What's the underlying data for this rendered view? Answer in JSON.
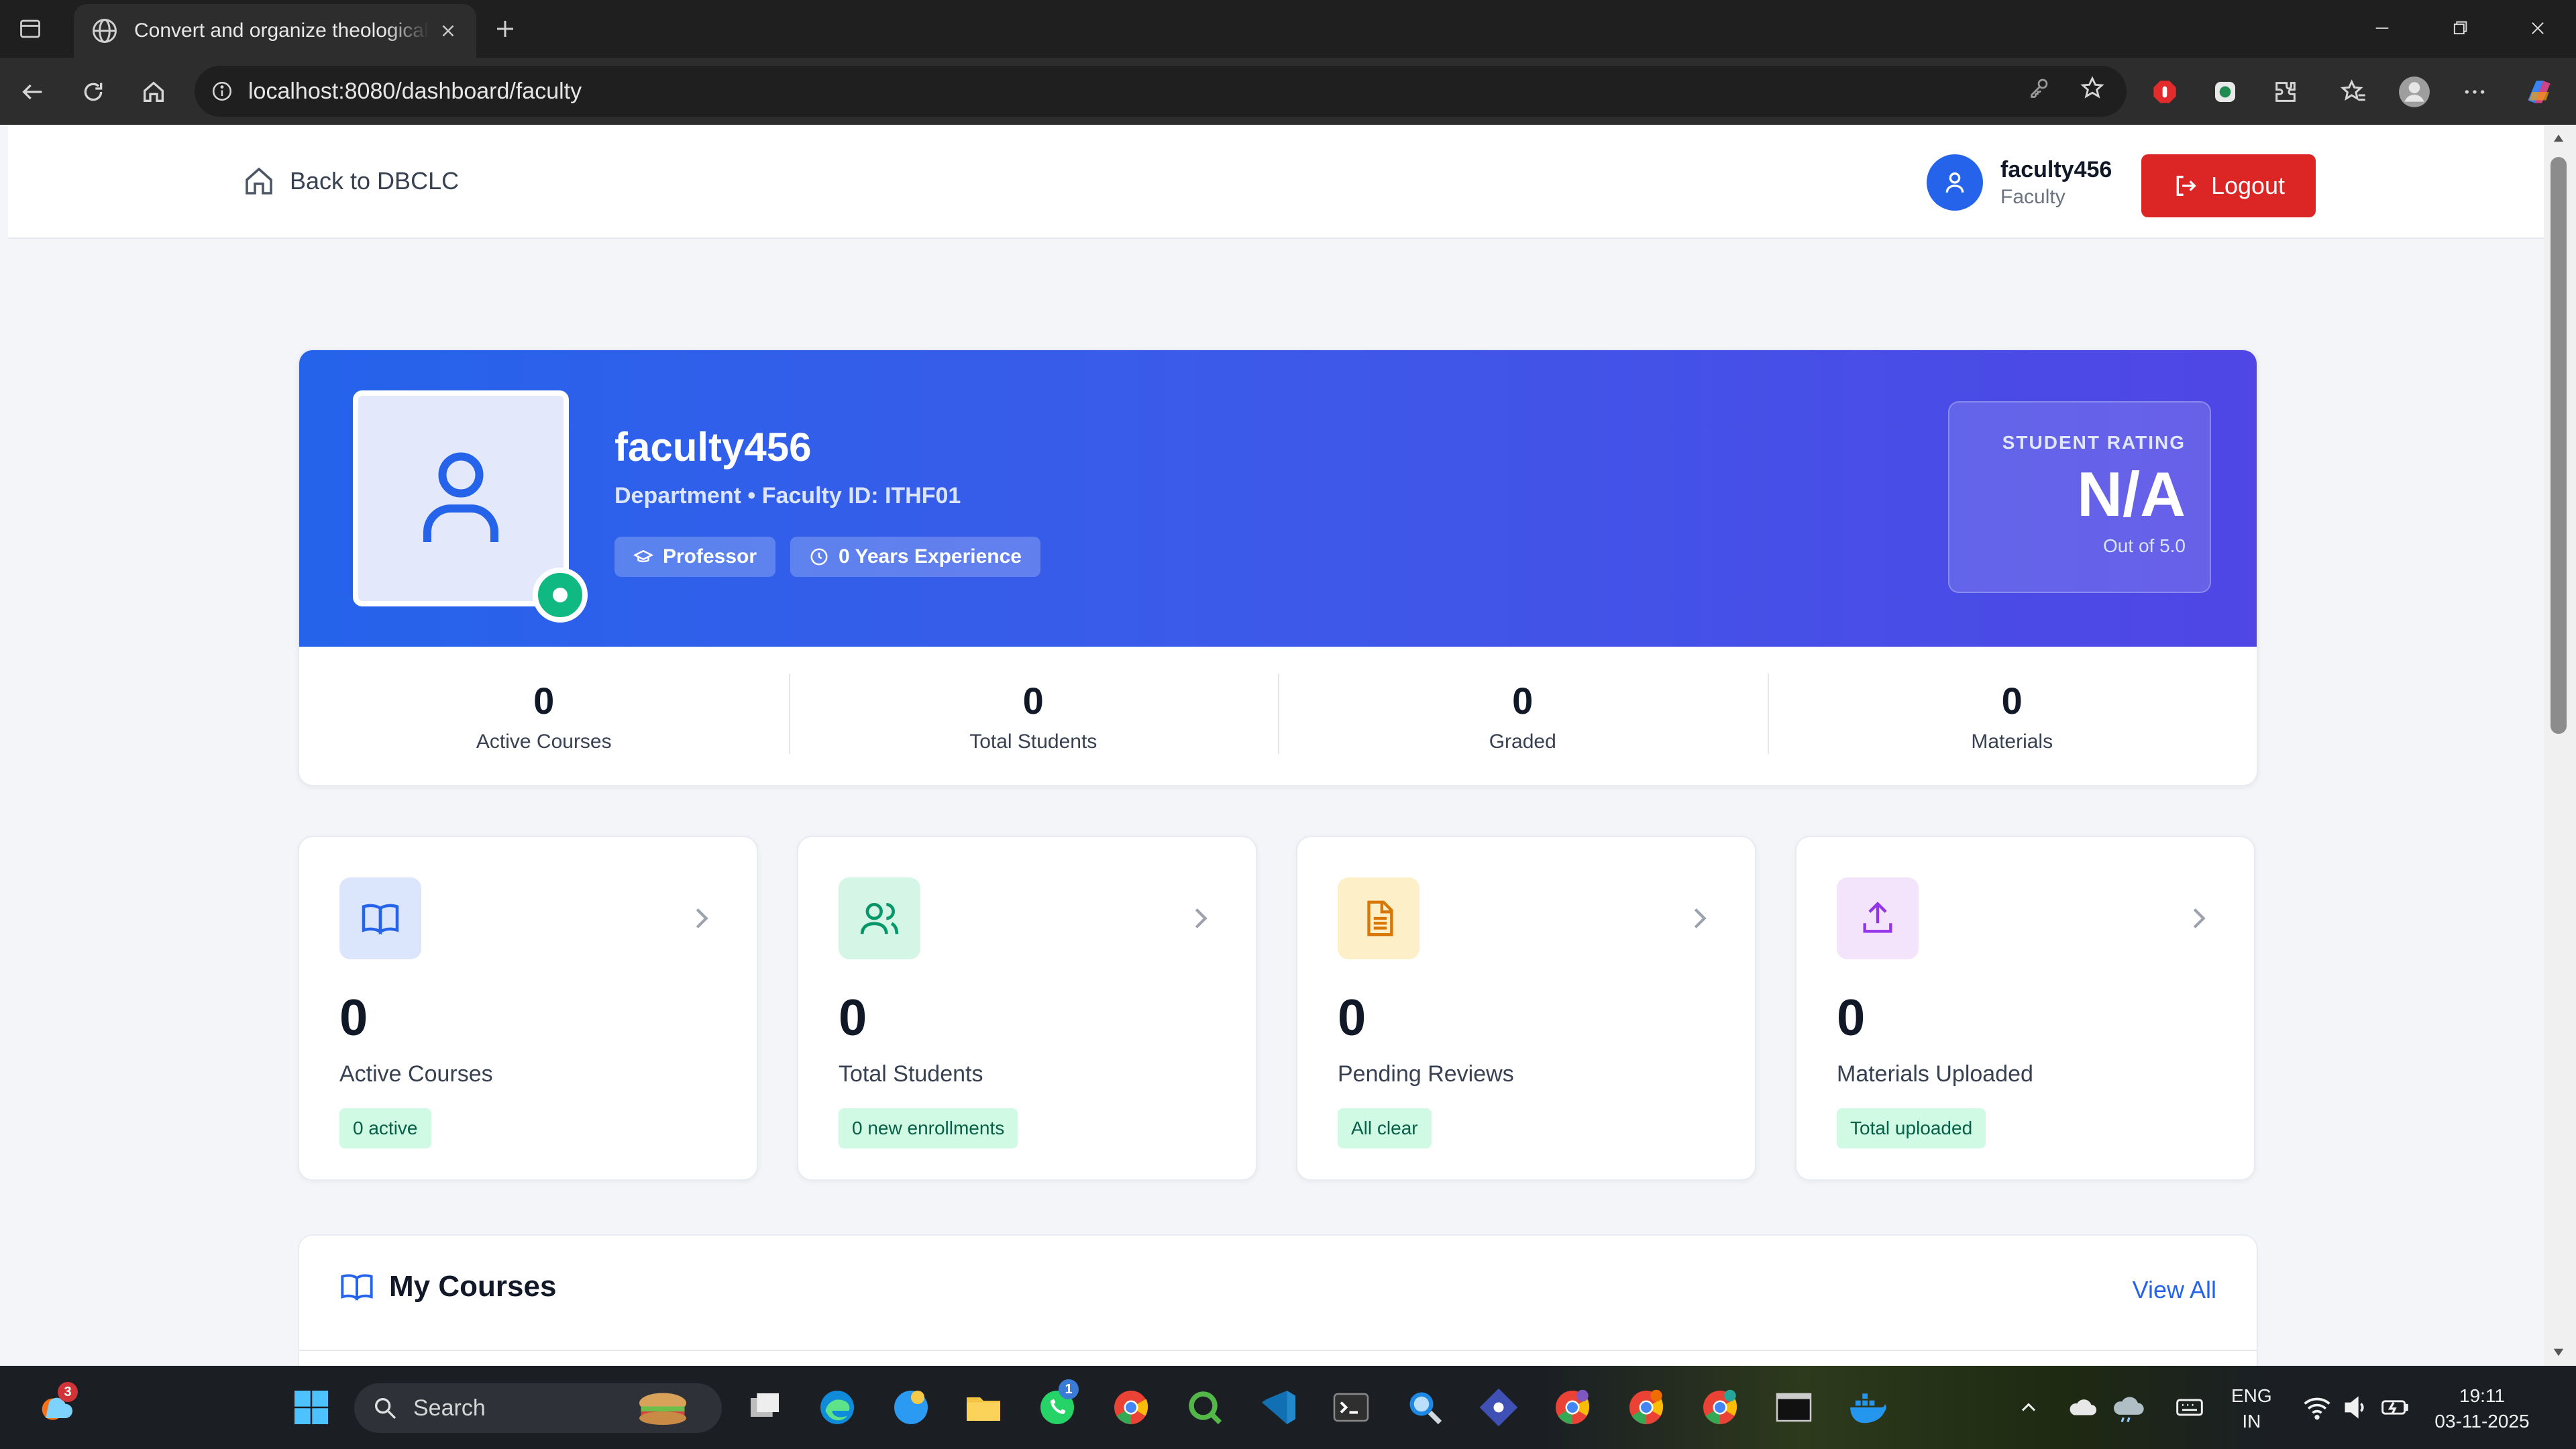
{
  "browser": {
    "tab_title": "Convert and organize theological",
    "url": "localhost:8080/dashboard/faculty"
  },
  "header": {
    "back_label": "Back to DBCLC",
    "username": "faculty456",
    "role": "Faculty",
    "logout_label": "Logout"
  },
  "profile": {
    "name": "faculty456",
    "department": "Department • Faculty ID: ITHF01",
    "chip_title": "Professor",
    "chip_experience": "0 Years Experience",
    "rating_label": "STUDENT RATING",
    "rating_value": "N/A",
    "rating_sub": "Out of 5.0"
  },
  "stats": [
    {
      "value": "0",
      "label": "Active Courses"
    },
    {
      "value": "0",
      "label": "Total Students"
    },
    {
      "value": "0",
      "label": "Graded"
    },
    {
      "value": "0",
      "label": "Materials"
    }
  ],
  "metrics": [
    {
      "value": "0",
      "label": "Active Courses",
      "badge": "0 active",
      "icon": "book-icon",
      "icon_bg": "#dbe6fd",
      "icon_color": "#2563eb"
    },
    {
      "value": "0",
      "label": "Total Students",
      "badge": "0 new enrollments",
      "icon": "users-icon",
      "icon_bg": "#d5f5e6",
      "icon_color": "#059669"
    },
    {
      "value": "0",
      "label": "Pending Reviews",
      "badge": "All clear",
      "icon": "document-icon",
      "icon_bg": "#fdefc7",
      "icon_color": "#d97706"
    },
    {
      "value": "0",
      "label": "Materials Uploaded",
      "badge": "Total uploaded",
      "icon": "upload-icon",
      "icon_bg": "#f3e3fb",
      "icon_color": "#9333ea"
    }
  ],
  "courses": {
    "title": "My Courses",
    "view_all": "View All"
  },
  "taskbar": {
    "search_placeholder": "Search",
    "lang_top": "ENG",
    "lang_bottom": "IN",
    "time": "19:11",
    "date": "03-11-2025",
    "notification_count": "3",
    "whatsapp_count": "1"
  },
  "colors": {
    "primary": "#2563eb",
    "logout": "#dc2626",
    "success": "#10b981"
  }
}
